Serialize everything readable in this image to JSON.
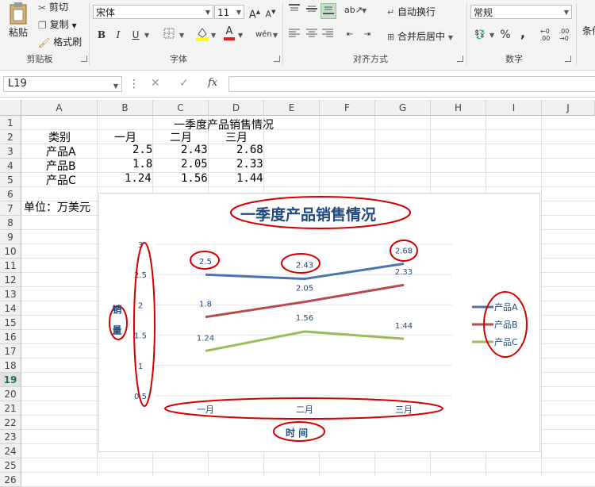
{
  "ribbon": {
    "clipboard": {
      "paste": "粘贴",
      "cut": "剪切",
      "copy": "复制",
      "format_painter": "格式刷",
      "label": "剪贴板"
    },
    "font": {
      "name": "宋体",
      "size": "11",
      "label": "字体",
      "bold": "B",
      "italic": "I",
      "underline": "U"
    },
    "alignment": {
      "wrap": "自动换行",
      "merge": "合并后居中",
      "label": "对齐方式"
    },
    "number": {
      "format": "常规",
      "label": "数字",
      "percent": "%",
      "comma": ","
    },
    "styles": {
      "partial": "条件"
    }
  },
  "formula_bar": {
    "name_box": "L19",
    "fx": "fx",
    "value": ""
  },
  "columns": [
    "A",
    "B",
    "C",
    "D",
    "E",
    "F",
    "G",
    "H",
    "I",
    "J"
  ],
  "rows": [
    "1",
    "2",
    "3",
    "4",
    "5",
    "6",
    "7",
    "8",
    "9",
    "10",
    "11",
    "12",
    "13",
    "14",
    "15",
    "16",
    "17",
    "18",
    "19",
    "20",
    "21",
    "22",
    "23",
    "24",
    "25",
    "26"
  ],
  "selected_row": "19",
  "sheet": {
    "title": "一季度产品销售情况",
    "header": [
      "类别",
      "一月",
      "二月",
      "三月"
    ],
    "data": [
      [
        "产品A",
        "2.5",
        "2.43",
        "2.68"
      ],
      [
        "产品B",
        "1.8",
        "2.05",
        "2.33"
      ],
      [
        "产品C",
        "1.24",
        "1.56",
        "1.44"
      ]
    ],
    "unit_note": "单位：万美元"
  },
  "chart_data": {
    "type": "line",
    "title": "一季度产品销售情况",
    "categories": [
      "一月",
      "二月",
      "三月"
    ],
    "series": [
      {
        "name": "产品A",
        "values": [
          2.5,
          2.43,
          2.68
        ],
        "color": "#4a74b0"
      },
      {
        "name": "产品B",
        "values": [
          1.8,
          2.05,
          2.33
        ],
        "color": "#b84a4a"
      },
      {
        "name": "产品C",
        "values": [
          1.24,
          1.56,
          1.44
        ],
        "color": "#9bbb59"
      }
    ],
    "xlabel": "时 间",
    "ylabel": "销 量",
    "yticks": [
      "0.5",
      "1",
      "1.5",
      "2",
      "2.5",
      "3"
    ],
    "ylim": [
      0.5,
      3
    ],
    "legend": "right",
    "grid": true,
    "annotation_color": "#d40000"
  }
}
